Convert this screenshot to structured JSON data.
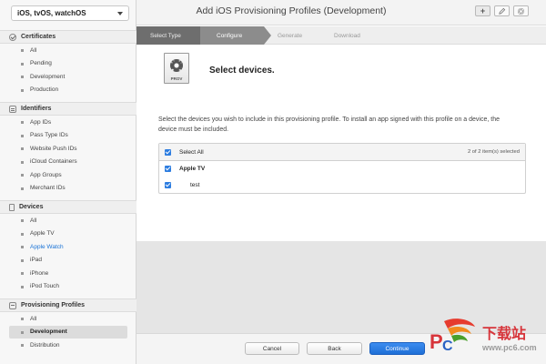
{
  "sidebar": {
    "platform": "iOS, tvOS, watchOS",
    "sections": [
      {
        "title": "Certificates",
        "items": [
          "All",
          "Pending",
          "Development",
          "Production"
        ]
      },
      {
        "title": "Identifiers",
        "items": [
          "App IDs",
          "Pass Type IDs",
          "Website Push IDs",
          "iCloud Containers",
          "App Groups",
          "Merchant IDs"
        ]
      },
      {
        "title": "Devices",
        "items": [
          "All",
          "Apple TV",
          "Apple Watch",
          "iPad",
          "iPhone",
          "iPod Touch"
        ]
      },
      {
        "title": "Provisioning Profiles",
        "items": [
          "All",
          "Development",
          "Distribution"
        ]
      }
    ]
  },
  "header": {
    "title": "Add iOS Provisioning Profiles (Development)",
    "add_icon": "+",
    "edit_icon": "pencil-icon",
    "settings_icon": "gear-icon"
  },
  "steps": [
    "Select Type",
    "Configure",
    "Generate",
    "Download"
  ],
  "main": {
    "icon_label": "PROV",
    "heading": "Select devices.",
    "description": "Select the devices you wish to include in this provisioning profile. To install an app signed with this profile on a device, the device must be included.",
    "select_all": "Select All",
    "count": "2  of 2 item(s) selected",
    "devices": [
      "Apple TV",
      "test"
    ]
  },
  "footer": {
    "cancel": "Cancel",
    "back": "Back",
    "continue": "Continue"
  },
  "watermark": {
    "text": "下载站",
    "url": "www.pc6.com"
  },
  "colors": {
    "accent": "#2d7de0",
    "active_link": "#1a73d6"
  }
}
